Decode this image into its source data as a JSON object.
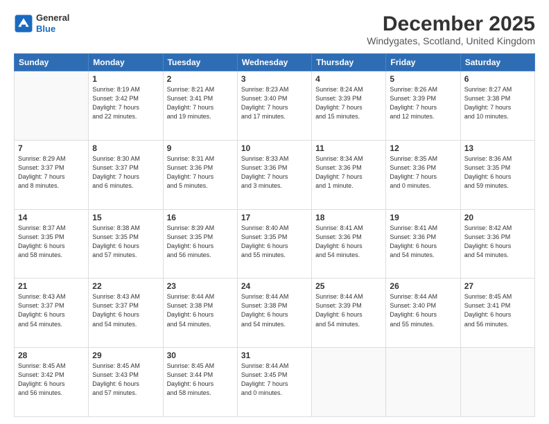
{
  "logo": {
    "line1": "General",
    "line2": "Blue"
  },
  "title": "December 2025",
  "subtitle": "Windygates, Scotland, United Kingdom",
  "weekdays": [
    "Sunday",
    "Monday",
    "Tuesday",
    "Wednesday",
    "Thursday",
    "Friday",
    "Saturday"
  ],
  "weeks": [
    [
      {
        "day": "",
        "info": ""
      },
      {
        "day": "1",
        "info": "Sunrise: 8:19 AM\nSunset: 3:42 PM\nDaylight: 7 hours\nand 22 minutes."
      },
      {
        "day": "2",
        "info": "Sunrise: 8:21 AM\nSunset: 3:41 PM\nDaylight: 7 hours\nand 19 minutes."
      },
      {
        "day": "3",
        "info": "Sunrise: 8:23 AM\nSunset: 3:40 PM\nDaylight: 7 hours\nand 17 minutes."
      },
      {
        "day": "4",
        "info": "Sunrise: 8:24 AM\nSunset: 3:39 PM\nDaylight: 7 hours\nand 15 minutes."
      },
      {
        "day": "5",
        "info": "Sunrise: 8:26 AM\nSunset: 3:39 PM\nDaylight: 7 hours\nand 12 minutes."
      },
      {
        "day": "6",
        "info": "Sunrise: 8:27 AM\nSunset: 3:38 PM\nDaylight: 7 hours\nand 10 minutes."
      }
    ],
    [
      {
        "day": "7",
        "info": "Sunrise: 8:29 AM\nSunset: 3:37 PM\nDaylight: 7 hours\nand 8 minutes."
      },
      {
        "day": "8",
        "info": "Sunrise: 8:30 AM\nSunset: 3:37 PM\nDaylight: 7 hours\nand 6 minutes."
      },
      {
        "day": "9",
        "info": "Sunrise: 8:31 AM\nSunset: 3:36 PM\nDaylight: 7 hours\nand 5 minutes."
      },
      {
        "day": "10",
        "info": "Sunrise: 8:33 AM\nSunset: 3:36 PM\nDaylight: 7 hours\nand 3 minutes."
      },
      {
        "day": "11",
        "info": "Sunrise: 8:34 AM\nSunset: 3:36 PM\nDaylight: 7 hours\nand 1 minute."
      },
      {
        "day": "12",
        "info": "Sunrise: 8:35 AM\nSunset: 3:36 PM\nDaylight: 7 hours\nand 0 minutes."
      },
      {
        "day": "13",
        "info": "Sunrise: 8:36 AM\nSunset: 3:35 PM\nDaylight: 6 hours\nand 59 minutes."
      }
    ],
    [
      {
        "day": "14",
        "info": "Sunrise: 8:37 AM\nSunset: 3:35 PM\nDaylight: 6 hours\nand 58 minutes."
      },
      {
        "day": "15",
        "info": "Sunrise: 8:38 AM\nSunset: 3:35 PM\nDaylight: 6 hours\nand 57 minutes."
      },
      {
        "day": "16",
        "info": "Sunrise: 8:39 AM\nSunset: 3:35 PM\nDaylight: 6 hours\nand 56 minutes."
      },
      {
        "day": "17",
        "info": "Sunrise: 8:40 AM\nSunset: 3:35 PM\nDaylight: 6 hours\nand 55 minutes."
      },
      {
        "day": "18",
        "info": "Sunrise: 8:41 AM\nSunset: 3:36 PM\nDaylight: 6 hours\nand 54 minutes."
      },
      {
        "day": "19",
        "info": "Sunrise: 8:41 AM\nSunset: 3:36 PM\nDaylight: 6 hours\nand 54 minutes."
      },
      {
        "day": "20",
        "info": "Sunrise: 8:42 AM\nSunset: 3:36 PM\nDaylight: 6 hours\nand 54 minutes."
      }
    ],
    [
      {
        "day": "21",
        "info": "Sunrise: 8:43 AM\nSunset: 3:37 PM\nDaylight: 6 hours\nand 54 minutes."
      },
      {
        "day": "22",
        "info": "Sunrise: 8:43 AM\nSunset: 3:37 PM\nDaylight: 6 hours\nand 54 minutes."
      },
      {
        "day": "23",
        "info": "Sunrise: 8:44 AM\nSunset: 3:38 PM\nDaylight: 6 hours\nand 54 minutes."
      },
      {
        "day": "24",
        "info": "Sunrise: 8:44 AM\nSunset: 3:38 PM\nDaylight: 6 hours\nand 54 minutes."
      },
      {
        "day": "25",
        "info": "Sunrise: 8:44 AM\nSunset: 3:39 PM\nDaylight: 6 hours\nand 54 minutes."
      },
      {
        "day": "26",
        "info": "Sunrise: 8:44 AM\nSunset: 3:40 PM\nDaylight: 6 hours\nand 55 minutes."
      },
      {
        "day": "27",
        "info": "Sunrise: 8:45 AM\nSunset: 3:41 PM\nDaylight: 6 hours\nand 56 minutes."
      }
    ],
    [
      {
        "day": "28",
        "info": "Sunrise: 8:45 AM\nSunset: 3:42 PM\nDaylight: 6 hours\nand 56 minutes."
      },
      {
        "day": "29",
        "info": "Sunrise: 8:45 AM\nSunset: 3:43 PM\nDaylight: 6 hours\nand 57 minutes."
      },
      {
        "day": "30",
        "info": "Sunrise: 8:45 AM\nSunset: 3:44 PM\nDaylight: 6 hours\nand 58 minutes."
      },
      {
        "day": "31",
        "info": "Sunrise: 8:44 AM\nSunset: 3:45 PM\nDaylight: 7 hours\nand 0 minutes."
      },
      {
        "day": "",
        "info": ""
      },
      {
        "day": "",
        "info": ""
      },
      {
        "day": "",
        "info": ""
      }
    ]
  ]
}
